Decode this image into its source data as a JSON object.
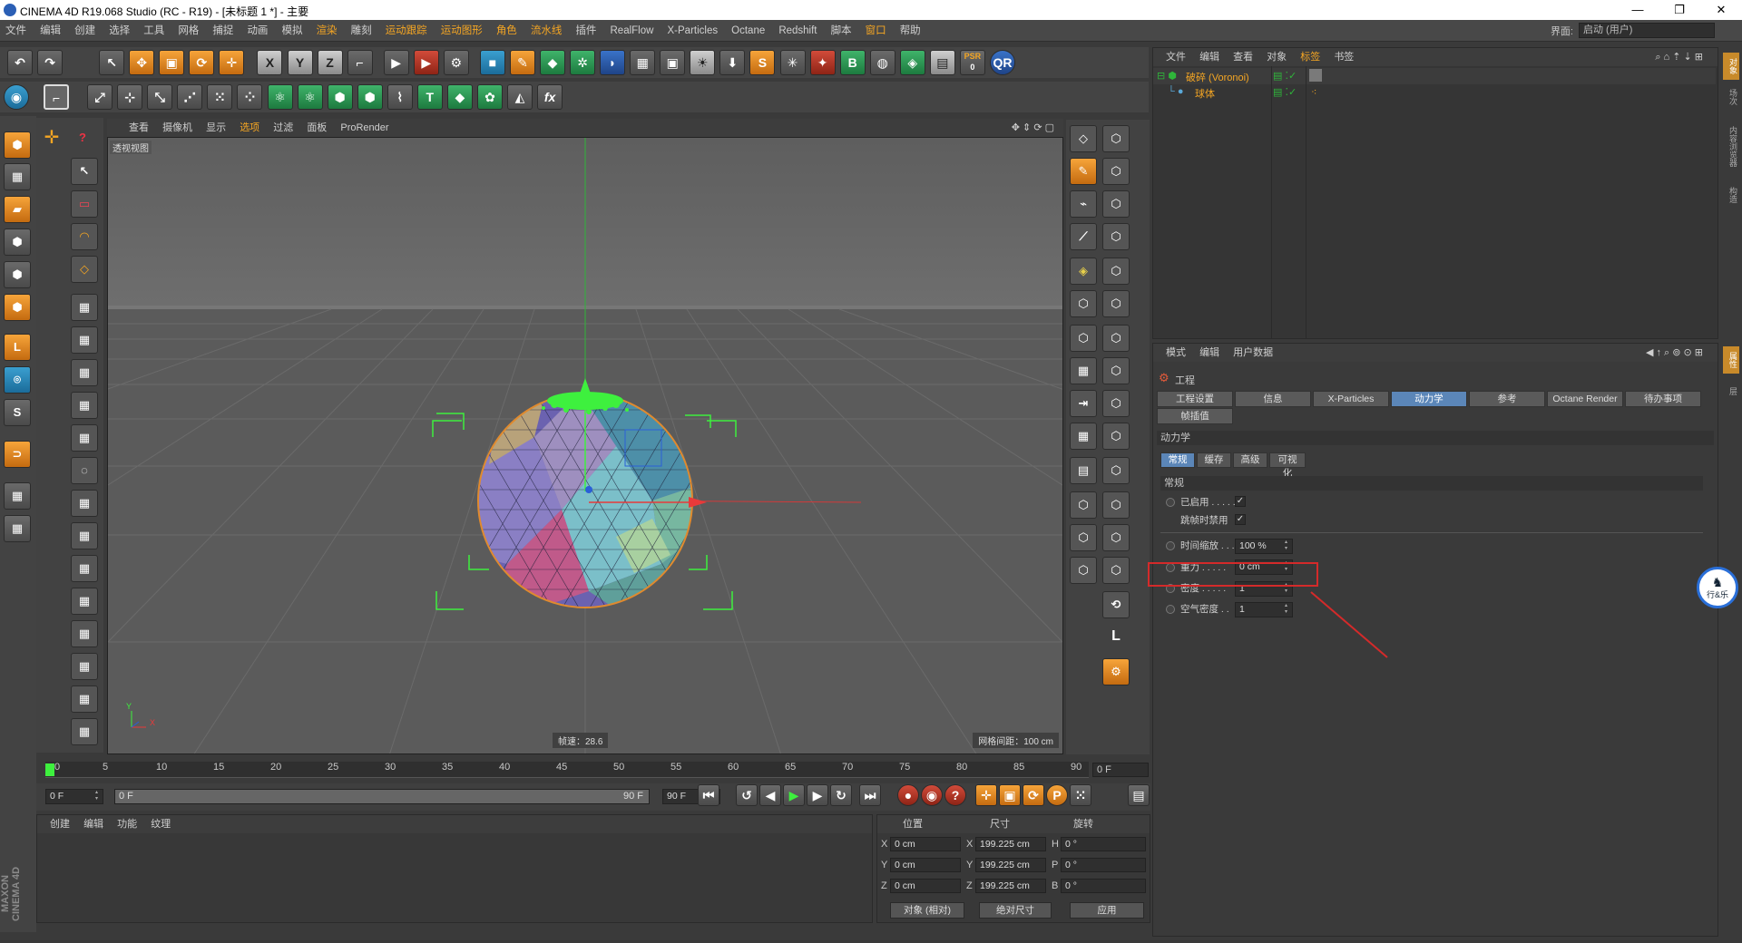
{
  "window": {
    "title": "CINEMA 4D R19.068 Studio (RC - R19) - [未标题 1 *] - 主要",
    "min": "—",
    "max": "❐",
    "close": "✕"
  },
  "menu": [
    "文件",
    "编辑",
    "创建",
    "选择",
    "工具",
    "网格",
    "捕捉",
    "动画",
    "模拟",
    "渲染",
    "雕刻",
    "运动跟踪",
    "运动图形",
    "角色",
    "流水线",
    "插件",
    "RealFlow",
    "X-Particles",
    "Octane",
    "Redshift",
    "脚本",
    "窗口",
    "帮助"
  ],
  "interface": {
    "label": "界面:",
    "value": "启动 (用户)"
  },
  "viewport": {
    "menu": [
      "查看",
      "摄像机",
      "显示",
      "选项",
      "过滤",
      "面板",
      "ProRender"
    ],
    "label": "透视视图",
    "fps": "帧速：28.6",
    "grid": "网格间距：100 cm",
    "axis_y": "Y",
    "axis_x": "X"
  },
  "object_manager": {
    "menu": [
      "文件",
      "编辑",
      "查看",
      "对象",
      "标签",
      "书签"
    ],
    "objects": [
      {
        "name": "破碎 (Voronoi)"
      },
      {
        "name": "球体"
      }
    ]
  },
  "attribute_manager": {
    "menu": [
      "模式",
      "编辑",
      "用户数据"
    ],
    "section": "工程",
    "tabs": [
      "工程设置",
      "信息",
      "X-Particles",
      "动力学",
      "参考",
      "Octane Render",
      "待办事项",
      "帧插值"
    ],
    "dyn_title": "动力学",
    "subtabs": [
      "常规",
      "缓存",
      "高级",
      "可视化"
    ],
    "group": "常规",
    "props": [
      {
        "label": "已启用 . . . . .",
        "check": "✓"
      },
      {
        "label": "跳帧时禁用",
        "check": "✓"
      },
      {
        "label": "时间缩放 . . .",
        "value": "100 %"
      },
      {
        "label": "重力 . . . . .",
        "value": "0 cm"
      },
      {
        "label": "密度 . . . . .",
        "value": "1"
      },
      {
        "label": "空气密度 . .",
        "value": "1"
      }
    ]
  },
  "side_tabs": [
    "对象",
    "场次",
    "内容浏览器",
    "构造",
    "属性",
    "层"
  ],
  "timeline": {
    "ticks": [
      "0",
      "5",
      "10",
      "15",
      "20",
      "25",
      "30",
      "35",
      "40",
      "45",
      "50",
      "55",
      "60",
      "65",
      "70",
      "75",
      "80",
      "85",
      "90"
    ],
    "frame_end": "0 F"
  },
  "transport": {
    "start": "0 F",
    "range_start": "0 F",
    "range_end": "90 F",
    "end": "90 F"
  },
  "materials": {
    "menu": [
      "创建",
      "编辑",
      "功能",
      "纹理"
    ],
    "logo": "MAXON CINEMA 4D"
  },
  "coords": {
    "headers": [
      "位置",
      "尺寸",
      "旋转"
    ],
    "rows": [
      {
        "axis": "X",
        "pos": "0 cm",
        "saxis": "X",
        "size": "199.225 cm",
        "raxis": "H",
        "rot": "0 °"
      },
      {
        "axis": "Y",
        "pos": "0 cm",
        "saxis": "Y",
        "size": "199.225 cm",
        "raxis": "P",
        "rot": "0 °"
      },
      {
        "axis": "Z",
        "pos": "0 cm",
        "saxis": "Z",
        "size": "199.225 cm",
        "raxis": "B",
        "rot": "0 °"
      }
    ],
    "mode1": "对象 (相对)",
    "mode2": "绝对尺寸",
    "apply": "应用"
  },
  "badge": "行&乐"
}
